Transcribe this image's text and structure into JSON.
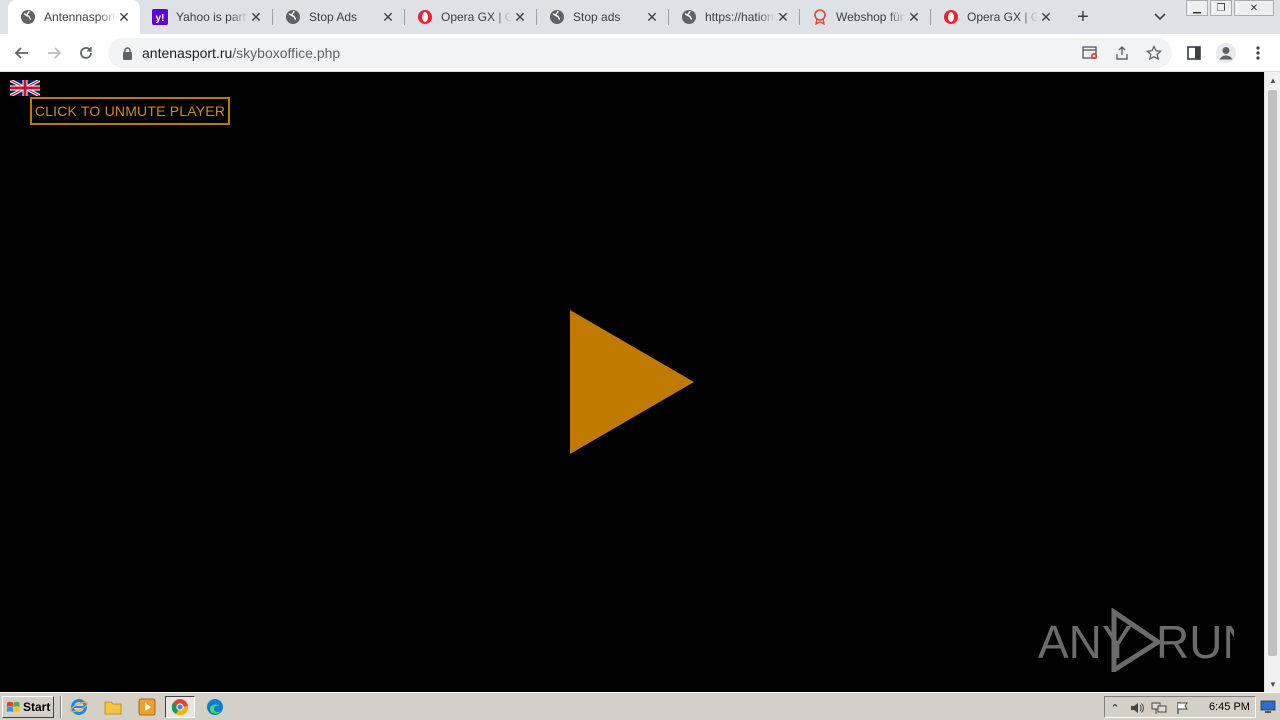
{
  "browser": {
    "tabs": [
      {
        "title": "Antennasport",
        "favicon": "globe-icon",
        "active": true
      },
      {
        "title": "Yahoo is part of",
        "favicon": "yahoo-icon",
        "active": false
      },
      {
        "title": "Stop Ads",
        "favicon": "globe-icon",
        "active": false
      },
      {
        "title": "Opera GX | Ga",
        "favicon": "opera-icon",
        "active": false
      },
      {
        "title": "Stop ads",
        "favicon": "globe-icon",
        "active": false
      },
      {
        "title": "https://hation",
        "favicon": "globe-icon",
        "active": false
      },
      {
        "title": "Webshop für",
        "favicon": "webshop-icon",
        "active": false
      },
      {
        "title": "Opera GX | Ga",
        "favicon": "opera-icon",
        "active": false
      }
    ],
    "address": {
      "host": "antenasport.ru",
      "path": "/skyboxoffice.php"
    }
  },
  "page": {
    "unmute_label": "CLICK TO UNMUTE PLAYER",
    "accent_color": "#c17a00",
    "watermark_left": "ANY",
    "watermark_right": "RUN"
  },
  "taskbar": {
    "start_label": "Start",
    "clock": "6:45 PM"
  }
}
